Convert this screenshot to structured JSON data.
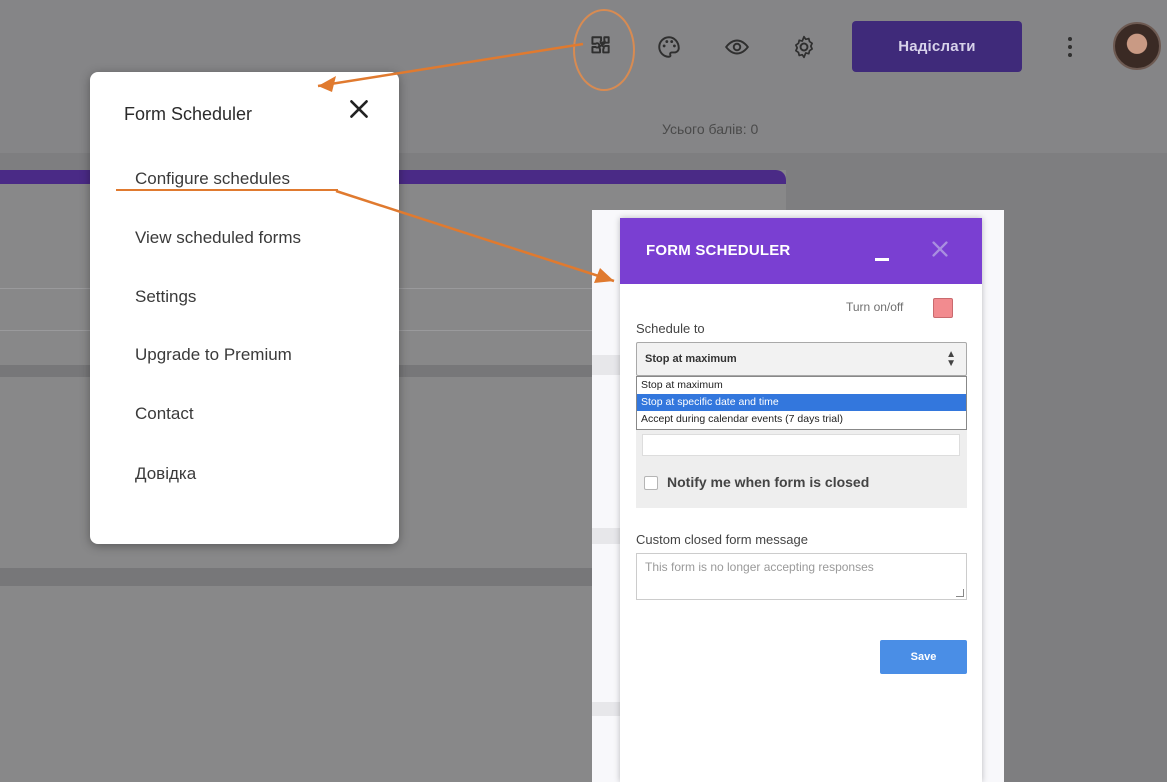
{
  "toolbar": {
    "icons": [
      "puzzle-icon",
      "palette-icon",
      "eye-icon",
      "gear-icon"
    ],
    "send_label": "Надіслати",
    "accent_color": "#3f2a7a"
  },
  "page": {
    "total_points": "Усього балів: 0"
  },
  "addon_menu": {
    "title": "Form Scheduler",
    "items": [
      {
        "label": "Configure schedules"
      },
      {
        "label": "View scheduled forms"
      },
      {
        "label": "Settings"
      },
      {
        "label": "Upgrade to Premium"
      },
      {
        "label": "Contact"
      },
      {
        "label": "Довідка"
      }
    ]
  },
  "dialog": {
    "title": "FORM SCHEDULER",
    "header_color": "#7a3fd2",
    "turn_label": "Turn on/off",
    "schedule_label": "Schedule to",
    "select_value": "Stop at maximum",
    "options": [
      {
        "label": "Stop at maximum"
      },
      {
        "label": "Stop at specific date and time"
      },
      {
        "label": "Accept during calendar events (7 days trial)"
      }
    ],
    "notify_label": "Notify me when form is closed",
    "custom_message_label": "Custom closed form message",
    "custom_message_placeholder": "This form is no longer accepting responses",
    "save_label": "Save"
  },
  "annotation_color": "#e07a2f"
}
